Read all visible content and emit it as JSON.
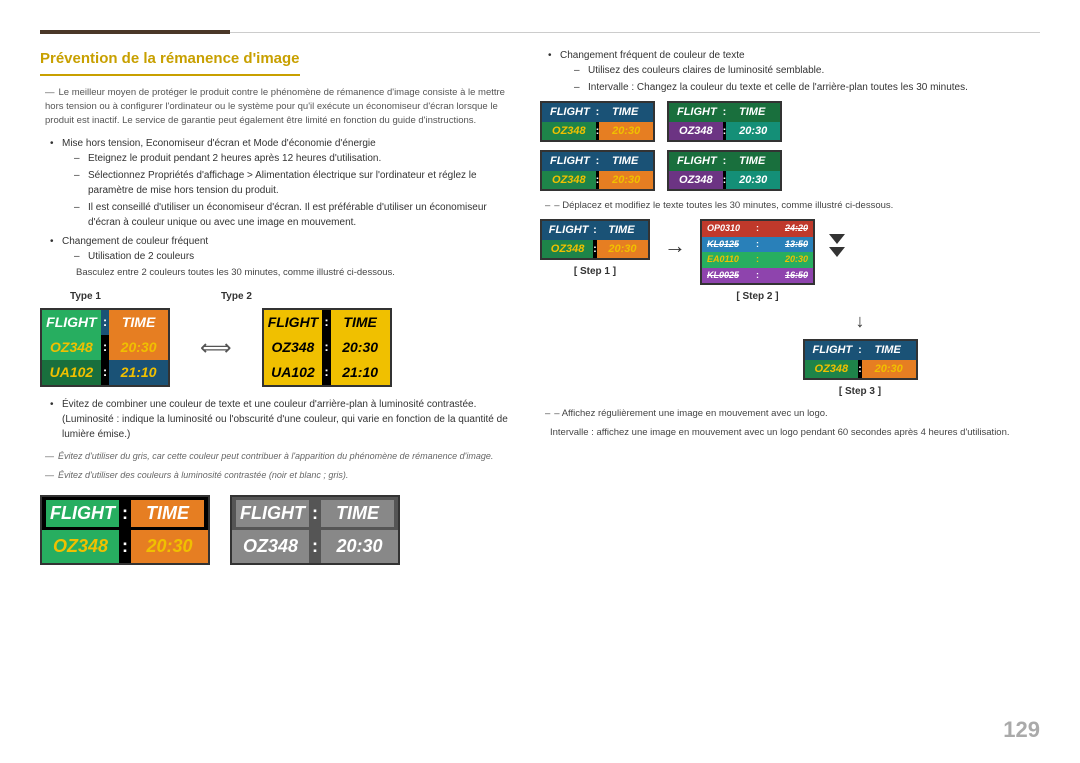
{
  "page": {
    "number": "129",
    "title": "Prévention de la rémanence d'image"
  },
  "left": {
    "intro_note": "Le meilleur moyen de protéger le produit contre le phénomène de rémanence d'image consiste à le mettre hors tension ou à configurer l'ordinateur ou le système pour qu'il exécute un économiseur d'écran lorsque le produit est inactif. Le service de garantie peut également être limité en fonction du guide d'instructions.",
    "bullets": [
      {
        "text": "Mise hors tension, Economiseur d'écran et Mode d'économie d'énergie",
        "subs": [
          "Eteignez le produit pendant 2 heures après 12 heures d'utilisation.",
          "Sélectionnez Propriétés d'affichage > Alimentation électrique sur l'ordinateur et réglez le paramètre de mise hors tension du produit.",
          "Il est conseillé d'utiliser un économiseur d'écran. Il est préférable d'utiliser un économiseur d'écran à couleur unique ou avec une image en mouvement."
        ]
      },
      {
        "text": "Changement de couleur fréquent",
        "subs": [
          "Utilisation de 2 couleurs"
        ],
        "note": "Basculez entre 2 couleurs toutes les 30 minutes, comme illustré ci-dessous."
      }
    ],
    "type1_label": "Type 1",
    "type2_label": "Type 2",
    "board1": {
      "header": [
        "FLIGHT",
        ":",
        "TIME"
      ],
      "row1": [
        "OZ348",
        ":",
        "20:30"
      ],
      "row2": [
        "UA102",
        ":",
        "21:10"
      ]
    },
    "board2": {
      "header": [
        "FLIGHT",
        ":",
        "TIME"
      ],
      "row1": [
        "OZ348",
        ":",
        "20:30"
      ],
      "row2": [
        "UA102",
        ":",
        "21:10"
      ]
    },
    "bullets2": [
      "Évitez de combiner une couleur de texte et une couleur d'arrière-plan à luminosité contrastée. (Luminosité : indique la luminosité ou l'obscurité d'une couleur, qui varie en fonction de la quantité de lumière émise.)"
    ],
    "italic_note1": "Évitez d'utiliser du gris, car cette couleur peut contribuer à l'apparition du phénomène de rémanence d'image.",
    "italic_note2": "Évitez d'utiliser des couleurs à luminosité contrastée (noir et blanc ; gris).",
    "bottom_board1": {
      "header": [
        "FLIGHT",
        ":",
        "TIME"
      ],
      "row1": [
        "OZ348",
        ":",
        "20:30"
      ]
    },
    "bottom_board2": {
      "header": [
        "FLIGHT",
        ":",
        "TIME"
      ],
      "row1": [
        "OZ348",
        ":",
        "20:30"
      ]
    }
  },
  "right": {
    "bullet1": "Changement fréquent de couleur de texte",
    "sub1_1": "Utilisez des couleurs claires de luminosité semblable.",
    "sub1_2": "Intervalle : Changez la couleur du texte et celle de l'arrière-plan toutes les 30 minutes.",
    "boards_row1": [
      {
        "h1": "FLIGHT",
        "h2": ":",
        "h3": "TIME",
        "d1": "OZ348",
        "d2": ":",
        "d3": "20:30",
        "header_bg": "#1a5276",
        "d1_bg": "#1e8449",
        "d3_bg": "#e67e22"
      },
      {
        "h1": "FLIGHT",
        "h2": ":",
        "h3": "TIME",
        "d1": "OZ348",
        "d2": ":",
        "d3": "20:30",
        "header_bg": "#196f3d",
        "d1_bg": "#6c3483",
        "d3_bg": "#148f77"
      }
    ],
    "boards_row2": [
      {
        "h1": "FLIGHT",
        "h2": ":",
        "h3": "TIME",
        "d1": "OZ348",
        "d2": ":",
        "d3": "20:30",
        "header_bg": "#1a5276",
        "d1_bg": "#1e8449",
        "d3_bg": "#e67e22"
      },
      {
        "h1": "FLIGHT",
        "h2": ":",
        "h3": "TIME",
        "d1": "OZ348",
        "d2": ":",
        "d3": "20:30",
        "header_bg": "#196f3d",
        "d1_bg": "#6c3483",
        "d3_bg": "#148f77"
      }
    ],
    "step_note": "– Déplacez et modifiez le texte toutes les 30 minutes, comme illustré ci-dessous.",
    "step1_label": "[ Step 1 ]",
    "step2_label": "[ Step 2 ]",
    "step3_label": "[ Step 3 ]",
    "step1_board": {
      "h1": "FLIGHT",
      "h2": ":",
      "h3": "TIME",
      "d1": "OZ348",
      "d2": ":",
      "d3": "20:30"
    },
    "step2_rows": [
      {
        "code": "OP0310",
        "sep": ":",
        "time": "24:20",
        "bg": "#c0392b"
      },
      {
        "code": "KL0125",
        "sep": ":",
        "time": "13:50",
        "bg": "#2980b9"
      },
      {
        "code": "EA0110",
        "sep": ":",
        "time": "20:30",
        "bg": "#27ae60"
      },
      {
        "code": "KL0025",
        "sep": ":",
        "time": "16:50",
        "bg": "#8e44ad"
      }
    ],
    "step3_board": {
      "h1": "FLIGHT",
      "h2": ":",
      "h3": "TIME",
      "d1": "OZ348",
      "d2": ":",
      "d3": "20:30"
    },
    "final_note1": "– Affichez régulièrement une image en mouvement avec un logo.",
    "final_note2": "Intervalle : affichez une image en mouvement avec un logo pendant 60 secondes après 4 heures d'utilisation."
  }
}
